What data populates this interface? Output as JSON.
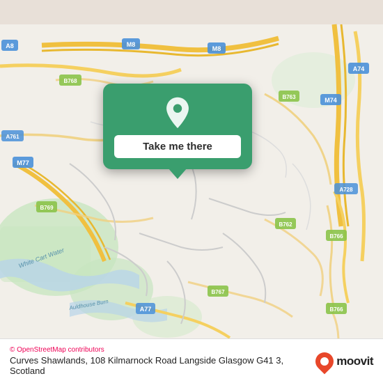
{
  "map": {
    "background_color": "#f2efe9",
    "attribution": "© OpenStreetMap contributors",
    "attribution_symbol": "©"
  },
  "popup": {
    "button_label": "Take me there",
    "pin_color": "#ffffff"
  },
  "bottom_bar": {
    "attribution_text": "OpenStreetMap contributors",
    "address": "Curves Shawlands, 108 Kilmarnock Road Langside Glasgow G41 3, Scotland"
  },
  "moovit": {
    "label": "moovit"
  },
  "roads": {
    "labels": [
      "A8",
      "M8",
      "M8",
      "A74",
      "M74",
      "A761",
      "B768",
      "M77",
      "B763",
      "A728",
      "B766",
      "B769",
      "B762",
      "A77",
      "B767",
      "B766",
      "White Cart Water",
      "Auldhouse Burn"
    ]
  }
}
